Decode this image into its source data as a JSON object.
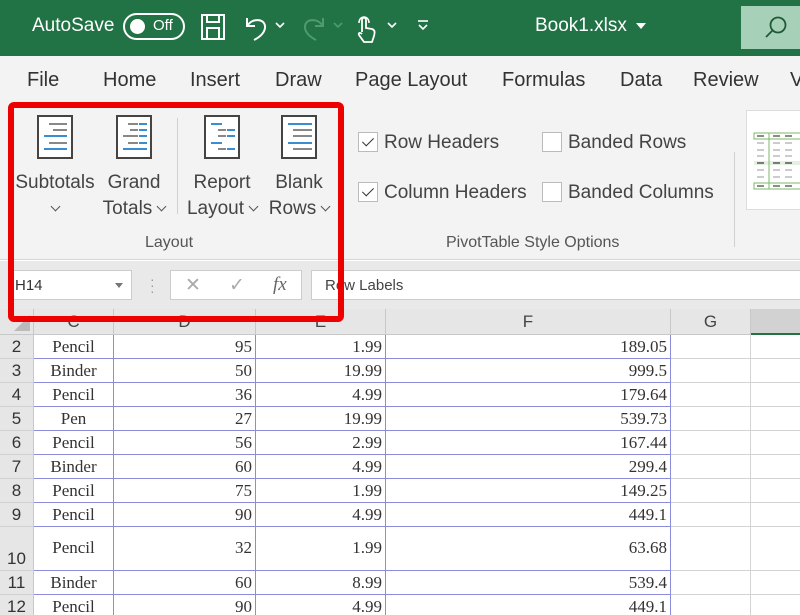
{
  "titlebar": {
    "autosave_label": "AutoSave",
    "autosave_state": "Off",
    "document_title": "Book1.xlsx",
    "icons": [
      "save-icon",
      "undo-icon",
      "redo-icon",
      "touch-mode-icon",
      "customize-qat-icon",
      "search-icon"
    ]
  },
  "tabs": [
    "File",
    "Home",
    "Insert",
    "Draw",
    "Page Layout",
    "Formulas",
    "Data",
    "Review",
    "V"
  ],
  "ribbon": {
    "layout_group": {
      "label": "Layout",
      "buttons": [
        {
          "line1": "Subtotals",
          "line2": ""
        },
        {
          "line1": "Grand",
          "line2": "Totals"
        },
        {
          "line1": "Report",
          "line2": "Layout"
        },
        {
          "line1": "Blank",
          "line2": "Rows"
        }
      ]
    },
    "style_options_group": {
      "label": "PivotTable Style Options",
      "options": [
        {
          "label": "Row Headers",
          "checked": true
        },
        {
          "label": "Banded Rows",
          "checked": false
        },
        {
          "label": "Column Headers",
          "checked": true
        },
        {
          "label": "Banded Columns",
          "checked": false
        }
      ]
    }
  },
  "formula_bar": {
    "name_box": "H14",
    "cancel_symbol": "✕",
    "enter_symbol": "✓",
    "fx_label": "fx",
    "formula": "Row Labels"
  },
  "grid": {
    "columns": [
      "C",
      "D",
      "E",
      "F",
      "G",
      ""
    ],
    "rows": [
      {
        "n": "2",
        "item": "Pencil",
        "units": "95",
        "cost": "1.99",
        "total": "189.05"
      },
      {
        "n": "3",
        "item": "Binder",
        "units": "50",
        "cost": "19.99",
        "total": "999.5"
      },
      {
        "n": "4",
        "item": "Pencil",
        "units": "36",
        "cost": "4.99",
        "total": "179.64"
      },
      {
        "n": "5",
        "item": "Pen",
        "units": "27",
        "cost": "19.99",
        "total": "539.73"
      },
      {
        "n": "6",
        "item": "Pencil",
        "units": "56",
        "cost": "2.99",
        "total": "167.44"
      },
      {
        "n": "7",
        "item": "Binder",
        "units": "60",
        "cost": "4.99",
        "total": "299.4"
      },
      {
        "n": "8",
        "item": "Pencil",
        "units": "75",
        "cost": "1.99",
        "total": "149.25"
      },
      {
        "n": "9",
        "item": "Pencil",
        "units": "90",
        "cost": "4.99",
        "total": "449.1"
      },
      {
        "n": "10",
        "item": "Pencil",
        "units": "32",
        "cost": "1.99",
        "total": "63.68"
      },
      {
        "n": "11",
        "item": "Binder",
        "units": "60",
        "cost": "8.99",
        "total": "539.4"
      },
      {
        "n": "12",
        "item": "Pencil",
        "units": "90",
        "cost": "4.99",
        "total": "449.1"
      }
    ]
  },
  "colors": {
    "title_bar": "#217346",
    "highlight": "#ee0000",
    "cell_border": "#8c8cdd"
  }
}
